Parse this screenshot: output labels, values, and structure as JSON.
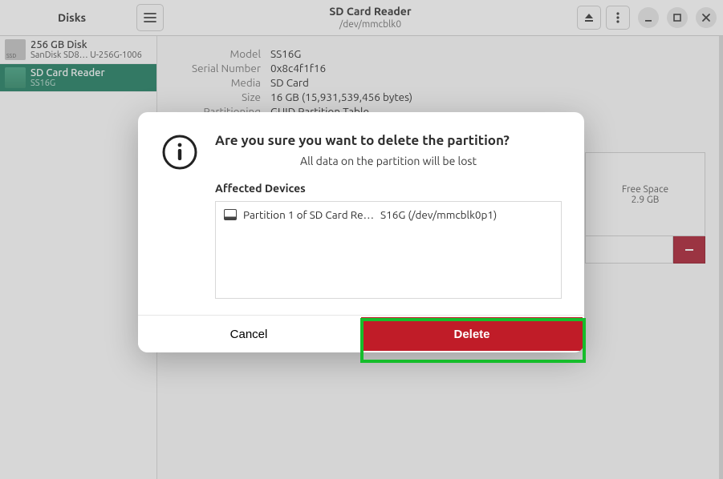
{
  "header": {
    "app_title": "Disks",
    "device_title": "SD Card Reader",
    "device_subtitle": "/dev/mmcblk0"
  },
  "sidebar": {
    "items": [
      {
        "title": "256 GB Disk",
        "subtitle": "SanDisk SD8…  U-256G-1006",
        "selected": false,
        "icon": "ssd"
      },
      {
        "title": "SD Card Reader",
        "subtitle": "SS16G",
        "selected": true,
        "icon": "sd"
      }
    ]
  },
  "info": {
    "rows": [
      {
        "label": "Model",
        "value": "SS16G"
      },
      {
        "label": "Serial Number",
        "value": "0x8c4f1f16"
      },
      {
        "label": "Media",
        "value": "SD Card"
      },
      {
        "label": "Size",
        "value": "16 GB (15,931,539,456 bytes)"
      },
      {
        "label": "Partitioning",
        "value": "GUID Partition Table"
      }
    ]
  },
  "volume": {
    "label": "Free Space",
    "size": "2.9 GB"
  },
  "dialog": {
    "title": "Are you sure you want to delete the partition?",
    "subtitle": "All data on the partition will be lost",
    "affected_label": "Affected Devices",
    "affected": [
      {
        "name": "Partition 1 of SD Card Re…",
        "info": "S16G (/dev/mmcblk0p1)"
      }
    ],
    "cancel": "Cancel",
    "delete": "Delete"
  }
}
